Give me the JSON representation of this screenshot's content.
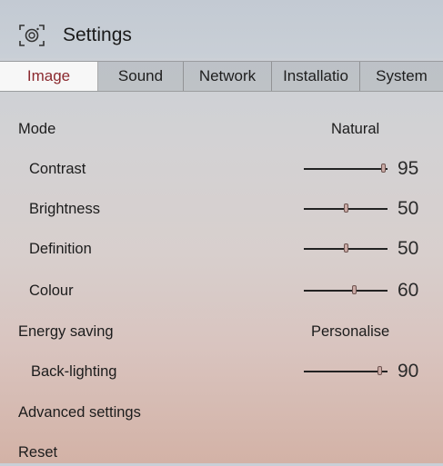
{
  "window": {
    "title": "Settings",
    "icon": "settings-camera-icon"
  },
  "tabs": [
    {
      "label": "Image",
      "active": true
    },
    {
      "label": "Sound",
      "active": false
    },
    {
      "label": "Network",
      "active": false
    },
    {
      "label": "Installatio",
      "active": false
    },
    {
      "label": "System",
      "active": false
    }
  ],
  "colors": {
    "active_tab_text": "#8b2a2f",
    "active_tab_background": "#f7f7f7"
  },
  "settings": {
    "mode": {
      "label": "Mode",
      "value": "Natural"
    },
    "contrast": {
      "label": "Contrast",
      "value": 95
    },
    "brightness": {
      "label": "Brightness",
      "value": 50
    },
    "definition": {
      "label": "Definition",
      "value": 50
    },
    "colour": {
      "label": "Colour",
      "value": 60
    },
    "energy_saving": {
      "label": "Energy saving",
      "value": "Personalise"
    },
    "back_lighting": {
      "label": "Back-lighting",
      "value": 90
    },
    "advanced": {
      "label": "Advanced settings"
    },
    "reset": {
      "label": "Reset"
    }
  }
}
